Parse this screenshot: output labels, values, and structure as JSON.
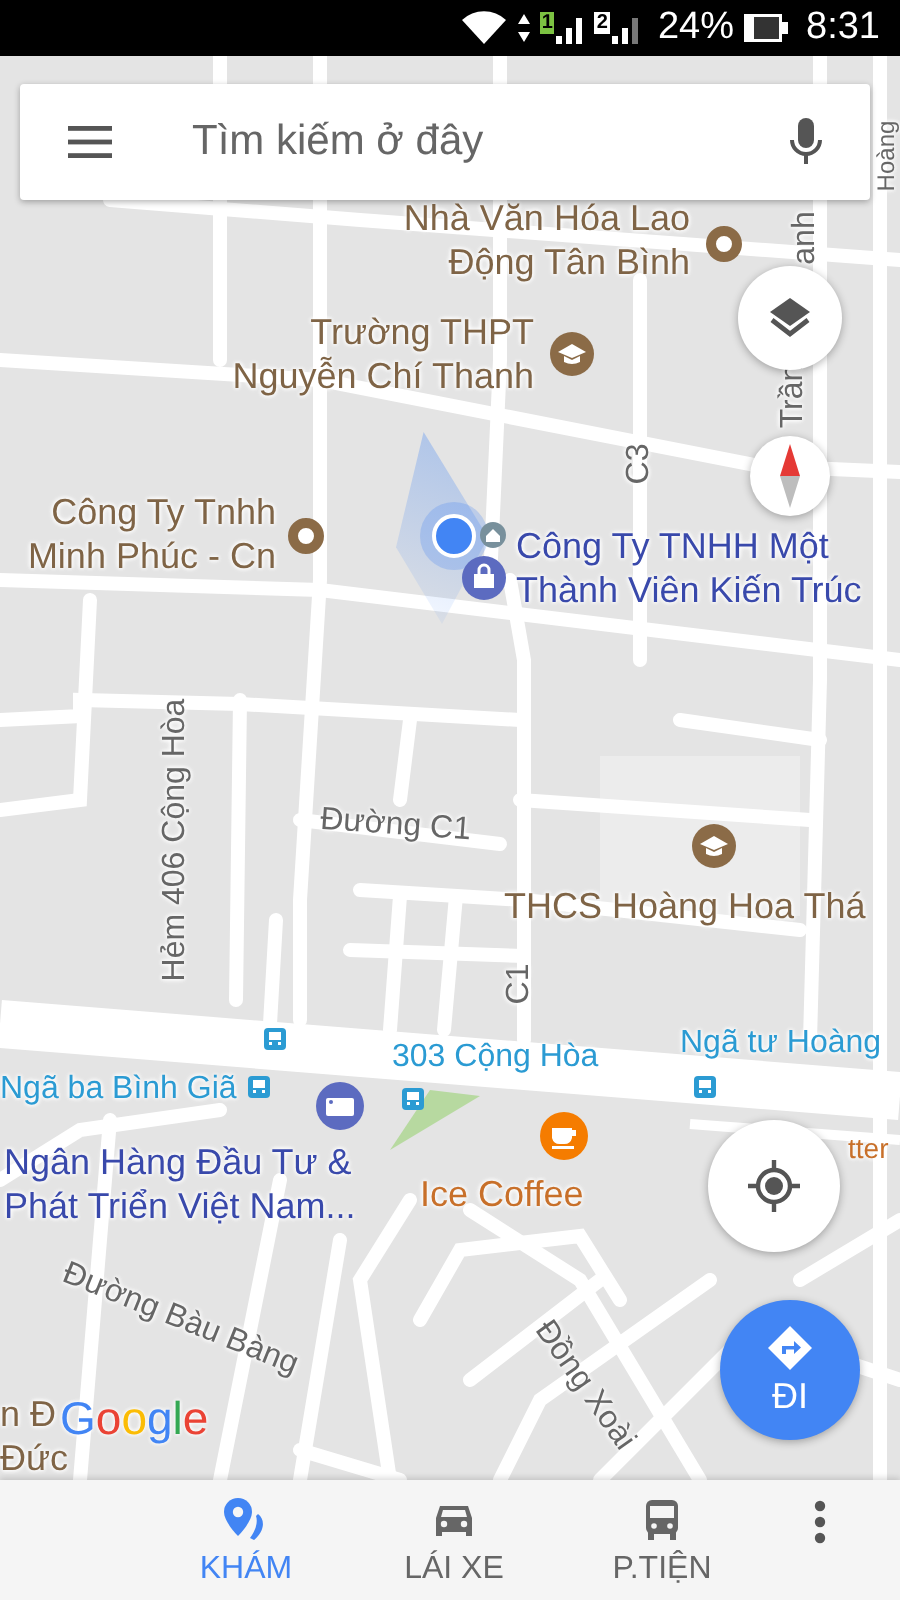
{
  "status_bar": {
    "sim_1": "1",
    "sim_2": "2",
    "battery": "24%",
    "time": "8:31"
  },
  "search": {
    "placeholder": "Tìm kiếm ở đây"
  },
  "map_labels": [
    {
      "kind": "poi",
      "text": "Nhà Văn Hóa Lao\nĐộng Tân Bình"
    },
    {
      "kind": "poi",
      "text": "Trường THPT\nNguyễn Chí Thanh"
    },
    {
      "kind": "poi",
      "text": "Công Ty Tnhh\nMinh Phúc - Cn"
    },
    {
      "kind": "business",
      "text": "Công Ty TNHH Một\nThành Viên Kiến Trúc"
    },
    {
      "kind": "street",
      "text": "Đường C1"
    },
    {
      "kind": "poi",
      "text": "THCS Hoàng Hoa Thá"
    },
    {
      "kind": "transit",
      "text": "303 Cộng Hòa"
    },
    {
      "kind": "transit",
      "text": "Ngã tư Hoàng"
    },
    {
      "kind": "transit",
      "text": "Ngã ba Bình Giã"
    },
    {
      "kind": "business",
      "text": "Ngân Hàng Đầu Tư &\nPhát Triển Việt Nam..."
    },
    {
      "kind": "food",
      "text": "Ice Coffee"
    },
    {
      "kind": "food",
      "text": "tter"
    },
    {
      "kind": "street",
      "text": "Hẻm 406 Cộng Hòa"
    },
    {
      "kind": "street",
      "text": "C3"
    },
    {
      "kind": "street",
      "text": "C1"
    },
    {
      "kind": "street",
      "text": "Trần"
    },
    {
      "kind": "street",
      "text": "anh"
    },
    {
      "kind": "street",
      "text": "Hoàng"
    },
    {
      "kind": "street",
      "text": "Đường Bàu Bàng"
    },
    {
      "kind": "street",
      "text": "Đồng Xoài"
    },
    {
      "kind": "poi",
      "text": "n Đ"
    },
    {
      "kind": "poi",
      "text": "Đức"
    }
  ],
  "google_logo": "Google",
  "directions_button": {
    "label": "ĐI"
  },
  "nav_tabs": [
    {
      "kind": "explore",
      "label": "KHÁM",
      "selected": true
    },
    {
      "kind": "drive",
      "label": "LÁI XE",
      "selected": false
    },
    {
      "kind": "transit",
      "label": "P.TIỆN",
      "selected": false
    }
  ]
}
